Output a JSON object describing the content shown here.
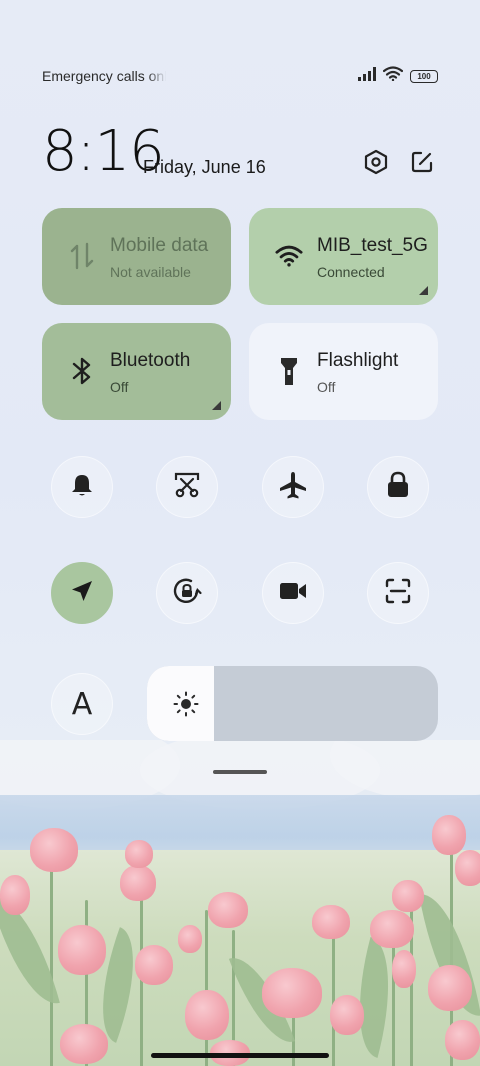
{
  "status_bar": {
    "carrier_text": "Emergency calls only",
    "signal_icon": "signal-bars-icon",
    "wifi_icon": "wifi-icon",
    "battery_level": "100"
  },
  "header": {
    "time": "8:16",
    "date": "Friday, June 16",
    "settings_icon": "settings-hexagon-icon",
    "edit_icon": "edit-icon"
  },
  "tiles": {
    "mobile_data": {
      "title": "Mobile data",
      "subtitle": "Not available",
      "icon": "mobile-data-icon",
      "state": "unavailable"
    },
    "wifi": {
      "title": "MIB_test_5G",
      "subtitle": "Connected",
      "icon": "wifi-icon",
      "state": "on"
    },
    "bluetooth": {
      "title": "Bluetooth",
      "subtitle": "Off",
      "icon": "bluetooth-icon",
      "state": "off"
    },
    "flashlight": {
      "title": "Flashlight",
      "subtitle": "Off",
      "icon": "flashlight-icon",
      "state": "off"
    }
  },
  "toggles_row1": [
    {
      "name": "ring-mode",
      "icon": "bell-icon",
      "active": false
    },
    {
      "name": "screenshot",
      "icon": "scissors-icon",
      "active": false
    },
    {
      "name": "airplane-mode",
      "icon": "airplane-icon",
      "active": false
    },
    {
      "name": "lock-screen",
      "icon": "lock-icon",
      "active": false
    }
  ],
  "toggles_row2": [
    {
      "name": "location",
      "icon": "location-arrow-icon",
      "active": true
    },
    {
      "name": "rotation-lock",
      "icon": "rotation-lock-icon",
      "active": false
    },
    {
      "name": "screen-recorder",
      "icon": "video-camera-icon",
      "active": false
    },
    {
      "name": "scanner",
      "icon": "scan-icon",
      "active": false
    }
  ],
  "bottom_row": {
    "font_size_label": "A",
    "font_icon": "font-size-icon",
    "brightness_icon": "sun-icon",
    "brightness_level": 0.23
  },
  "colors": {
    "tile_active_bg": "#a9c69f",
    "tile_unavailable_bg": "#9bb38f",
    "tile_inactive_bg": "#edf0f7"
  }
}
